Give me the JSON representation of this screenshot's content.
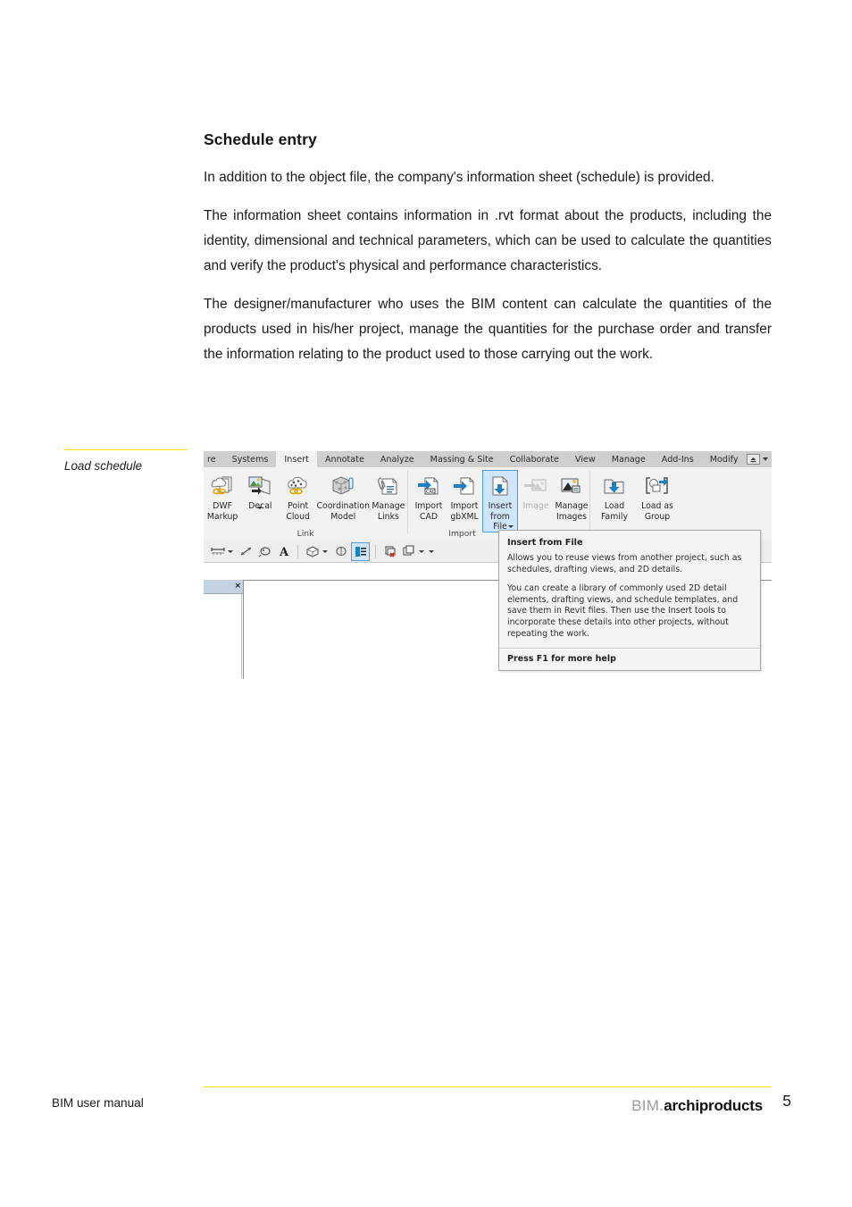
{
  "document": {
    "heading": "Schedule entry",
    "paragraphs": [
      "In addition to the object file, the company's information sheet (schedule) is provided.",
      "The information sheet contains information in .rvt format about the products, including the identity, dimensional and technical parameters, which can be used to calculate the quantities and verify the product's physical and performance characteristics.",
      "The designer/manufacturer who uses the BIM content can calculate the quantities of the products used in his/her project, manage the quantities for the purchase order and transfer the information relating to the product used to those carrying out the work."
    ]
  },
  "caption": {
    "text": "Load schedule"
  },
  "screenshot": {
    "ribbon_tabs": [
      {
        "label": "re",
        "active": false
      },
      {
        "label": "Systems",
        "active": false
      },
      {
        "label": "Insert",
        "active": true
      },
      {
        "label": "Annotate",
        "active": false
      },
      {
        "label": "Analyze",
        "active": false
      },
      {
        "label": "Massing & Site",
        "active": false
      },
      {
        "label": "Collaborate",
        "active": false
      },
      {
        "label": "View",
        "active": false
      },
      {
        "label": "Manage",
        "active": false
      },
      {
        "label": "Add-Ins",
        "active": false
      },
      {
        "label": "Modify",
        "active": false
      }
    ],
    "panels": [
      {
        "name": "Link",
        "label": "Link",
        "buttons": [
          {
            "icon": "dwf-markup-icon",
            "line1": "DWF",
            "line2": "Markup",
            "state": "normal",
            "dropdown": false
          },
          {
            "icon": "decal-icon",
            "line1": "Decal",
            "line2": "",
            "state": "normal",
            "dropdown": true
          },
          {
            "icon": "point-cloud-icon",
            "line1": "Point",
            "line2": "Cloud",
            "state": "normal",
            "dropdown": false
          },
          {
            "icon": "coordination-model-icon",
            "line1": "Coordination",
            "line2": "Model",
            "state": "normal",
            "dropdown": false
          },
          {
            "icon": "manage-links-icon",
            "line1": "Manage",
            "line2": "Links",
            "state": "normal",
            "dropdown": false
          }
        ]
      },
      {
        "name": "Import",
        "label": "Import",
        "buttons": [
          {
            "icon": "import-cad-icon",
            "line1": "Import",
            "line2": "CAD",
            "state": "normal",
            "dropdown": false
          },
          {
            "icon": "import-gbxml-icon",
            "line1": "Import",
            "line2": "gbXML",
            "state": "normal",
            "dropdown": false
          },
          {
            "icon": "insert-from-file-icon",
            "line1": "Insert",
            "line2": "from File",
            "state": "selected",
            "dropdown": true
          },
          {
            "icon": "image-icon",
            "line1": "Image",
            "line2": "",
            "state": "disabled",
            "dropdown": false
          },
          {
            "icon": "manage-images-icon",
            "line1": "Manage",
            "line2": "Images",
            "state": "normal",
            "dropdown": false
          }
        ]
      },
      {
        "name": "Load from Library",
        "label": "",
        "buttons": [
          {
            "icon": "load-family-icon",
            "line1": "Load",
            "line2": "Family",
            "state": "normal",
            "dropdown": false
          },
          {
            "icon": "load-as-group-icon",
            "line1": "Load as",
            "line2": "Group",
            "state": "normal",
            "dropdown": false
          }
        ]
      }
    ],
    "mini_toolbar": [
      {
        "icon": "align-dimension-icon",
        "caret": true
      },
      {
        "icon": "measure-icon",
        "caret": false
      },
      {
        "icon": "tag-icon",
        "caret": false
      },
      {
        "icon": "text-icon",
        "caret": false
      },
      {
        "icon": "section-box-icon",
        "caret": true
      },
      {
        "icon": "hide-element-icon",
        "caret": false
      },
      {
        "icon": "visibility-graphics-icon",
        "caret": false,
        "boxed": true
      },
      {
        "icon": "close-hidden-icon",
        "caret": false
      },
      {
        "icon": "switch-window-icon",
        "caret": true
      },
      {
        "icon": "overflow-icon",
        "caret": false
      }
    ],
    "side_panel": {
      "close_label": "×"
    },
    "tooltip": {
      "title": "Insert from File",
      "paragraph1": "Allows you to reuse views from another project, such as schedules, drafting views, and 2D details.",
      "paragraph2": "You can create a library of commonly used 2D detail elements, drafting views, and schedule templates, and save them in Revit files. Then use the Insert tools to incorporate these details into other projects, without repeating the work.",
      "footer": "Press F1 for more help"
    }
  },
  "footer": {
    "left_text": "BIM user manual",
    "logo_prefix": "BIM.",
    "logo_name": "archiproducts",
    "page_number": "5"
  },
  "colors": {
    "accent_yellow": "#ffe000",
    "ribbon_selected_fill": "#cfe6fa",
    "ribbon_selected_border": "#5a9fd4",
    "revit_blue": "#1f7fc4",
    "tab_strip": "#cfcfcf",
    "panel_bg": "#f2f2f2"
  }
}
